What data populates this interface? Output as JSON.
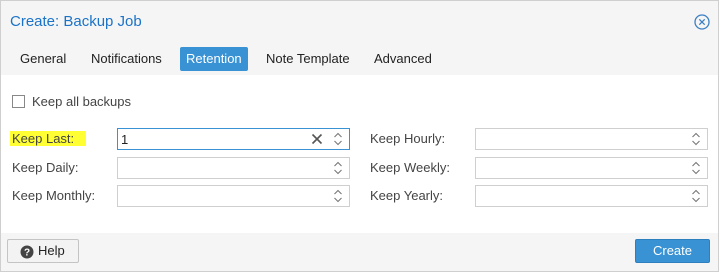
{
  "dialog": {
    "title": "Create: Backup Job"
  },
  "tabs": [
    {
      "label": "General",
      "active": false
    },
    {
      "label": "Notifications",
      "active": false
    },
    {
      "label": "Retention",
      "active": true
    },
    {
      "label": "Note Template",
      "active": false
    },
    {
      "label": "Advanced",
      "active": false
    }
  ],
  "retention": {
    "keep_all": {
      "label": "Keep all backups",
      "checked": false
    },
    "keep_last": {
      "label": "Keep Last:",
      "value": "1"
    },
    "keep_hourly": {
      "label": "Keep Hourly:",
      "value": ""
    },
    "keep_daily": {
      "label": "Keep Daily:",
      "value": ""
    },
    "keep_weekly": {
      "label": "Keep Weekly:",
      "value": ""
    },
    "keep_monthly": {
      "label": "Keep Monthly:",
      "value": ""
    },
    "keep_yearly": {
      "label": "Keep Yearly:",
      "value": ""
    }
  },
  "footer": {
    "help_label": "Help",
    "create_label": "Create"
  },
  "colors": {
    "accent": "#3892d4",
    "title": "#1a73c8",
    "highlight": "#ffff33"
  },
  "icons": {
    "close": "close-circle-icon",
    "help": "question-circle-icon",
    "clear": "clear-x-icon",
    "spinner": "up-down-arrows-icon"
  }
}
